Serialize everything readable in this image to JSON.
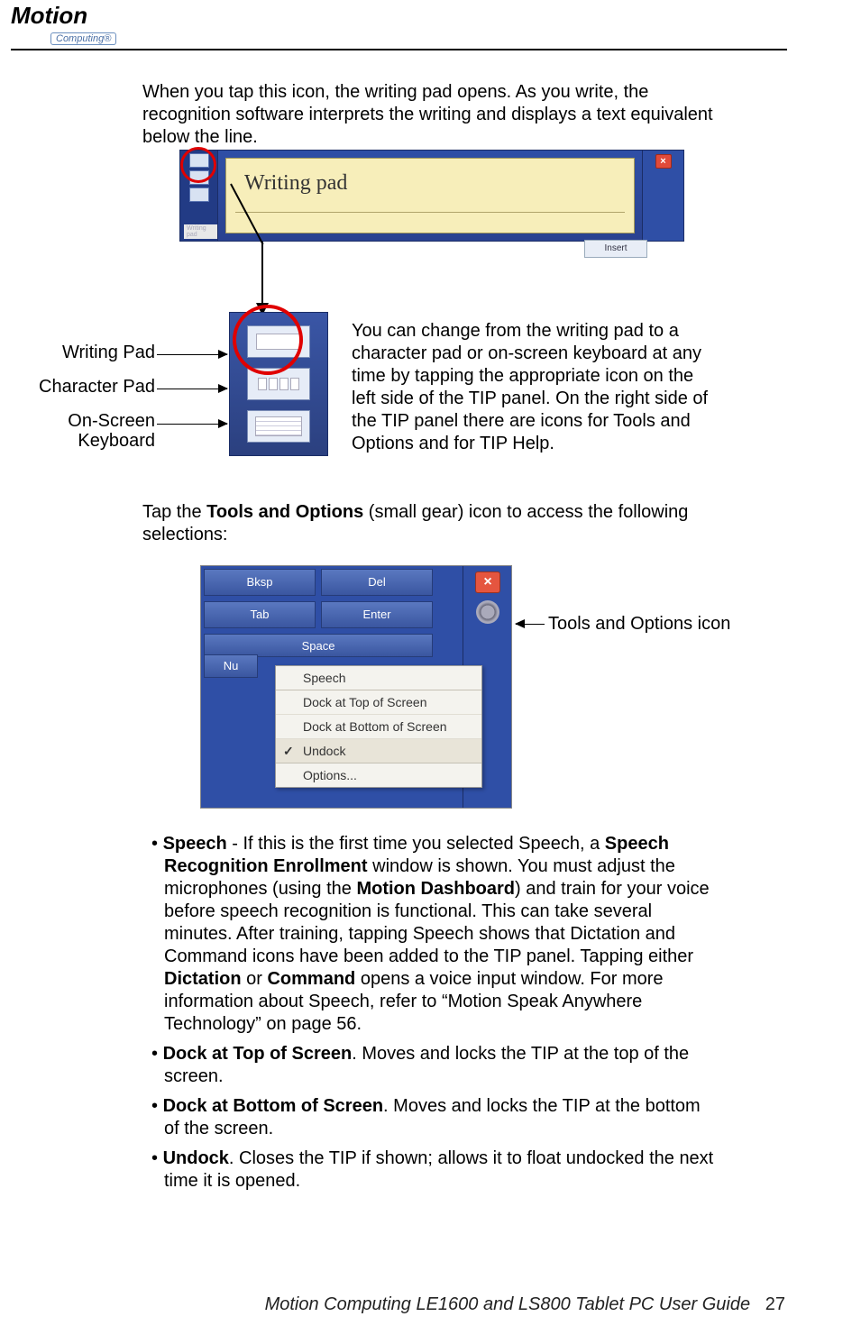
{
  "header": {
    "logo_main": "Motion",
    "logo_sub": "Computing®"
  },
  "intro_para": "When you tap this icon, the writing pad opens. As you write, the recognition software interprets the writing and displays a text equivalent below the line.",
  "tip_panel": {
    "tab_label": "Writing  pad",
    "handwriting": "Writing pad",
    "insert_button": "Insert",
    "close": "×"
  },
  "mode_labels": {
    "writing": "Writing Pad",
    "character": "Character Pad",
    "keyboard_l1": "On-Screen",
    "keyboard_l2": "Keyboard"
  },
  "side_para": "You can change from the writing pad to a character pad or on-screen keyboard at any time by tapping the appropriate icon on the left side of the TIP panel. On the right side of the TIP panel there are icons for Tools and Options and for TIP Help.",
  "tap_para_pre": "Tap the ",
  "tap_para_bold": "Tools and Options",
  "tap_para_post": " (small gear) icon to access the following selections:",
  "tools_fig": {
    "keys": {
      "bksp": "Bksp",
      "del": "Del",
      "tab": "Tab",
      "enter": "Enter",
      "space": "Space",
      "nu": "Nu"
    },
    "close": "×",
    "menu": {
      "speech": "Speech",
      "dock_top": "Dock at Top of Screen",
      "dock_bottom": "Dock at Bottom of Screen",
      "undock": "Undock",
      "options": "Options..."
    }
  },
  "tools_callout": "Tools and Options icon",
  "bullets": {
    "speech_b1": "Speech",
    "speech_t1": " - If this is the first time you selected Speech, a ",
    "speech_b2": "Speech Recog­nition Enrollment",
    "speech_t2": " window is shown. You must adjust the microphones (using the ",
    "speech_b3": "Motion Dashboard",
    "speech_t3": ") and train for your voice before speech recognition is functional. This can take several minutes. After training, tapping Speech shows that Dictation and Command icons have been added to the TIP panel. Tapping either ",
    "speech_b4": "Dictation",
    "speech_t4": " or ",
    "speech_b5": "Command",
    "speech_t5": " opens a voice input window. For more information about Speech, refer to “Motion Speak Anywhere Technology” on page 56.",
    "docktop_b": "Dock at Top of Screen",
    "docktop_t": ". Moves and locks the TIP at the top of the screen.",
    "dockbot_b": "Dock at Bottom of Screen",
    "dockbot_t": ". Moves and locks the TIP at the bottom of the screen.",
    "undock_b": "Undock",
    "undock_t": ". Closes the TIP if shown; allows it to float undocked the next time it is opened."
  },
  "footer": {
    "title": "Motion Computing LE1600 and LS800 Tablet PC User Guide",
    "page": "27"
  }
}
